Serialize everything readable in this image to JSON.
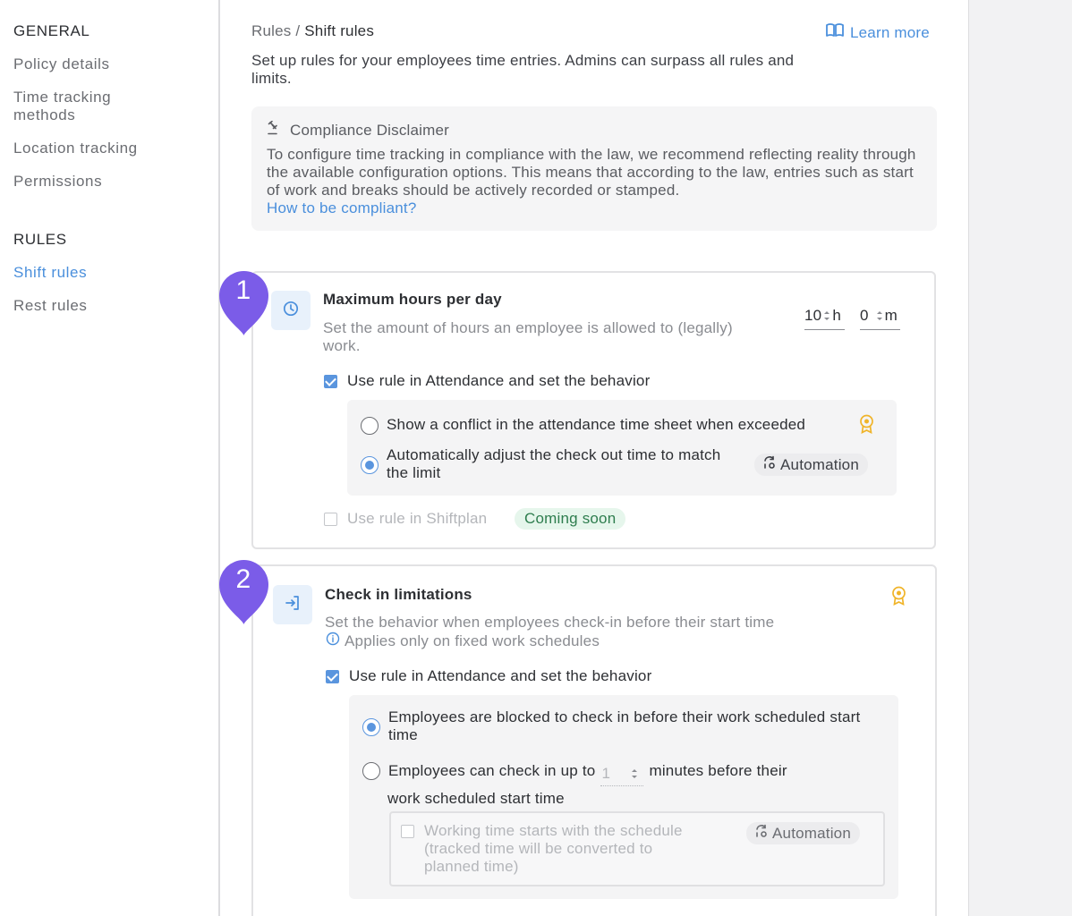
{
  "sidebar": {
    "general_heading": "GENERAL",
    "general_items": [
      {
        "label": "Policy details"
      },
      {
        "label": "Time tracking methods"
      },
      {
        "label": "Location tracking"
      },
      {
        "label": "Permissions"
      }
    ],
    "rules_heading": "RULES",
    "rules_items": [
      {
        "label": "Shift rules",
        "active": true
      },
      {
        "label": "Rest rules",
        "active": false
      }
    ]
  },
  "header": {
    "breadcrumb_parent": "Rules",
    "breadcrumb_separator": " / ",
    "breadcrumb_current": "Shift rules",
    "learn_more": "Learn more",
    "intro": "Set up rules for your employees time entries. Admins can surpass all rules and limits."
  },
  "disclaimer": {
    "title": "Compliance Disclaimer",
    "body": "To configure time tracking in compliance with the law, we recommend reflecting reality through the available configuration options. This means that according to the law, entries such as start of work and breaks should be actively recorded or stamped.",
    "link": "How to be compliant?"
  },
  "rule1": {
    "marker": "1",
    "icon": "clock-icon",
    "title": "Maximum hours per day",
    "description": "Set the amount of hours an employee is allowed to (legally) work.",
    "hours_value": "10",
    "hours_unit": "h",
    "minutes_value": "0",
    "minutes_unit": "m",
    "attendance_label": "Use rule in Attendance and set the behavior",
    "attendance_checked": true,
    "option_conflict": "Show a conflict in the attendance time sheet when exceeded",
    "option_adjust": "Automatically adjust the check out time to match the limit",
    "selected_option": "adjust",
    "automation_badge": "Automation",
    "shiftplan_label": "Use rule in Shiftplan",
    "shiftplan_checked": false,
    "coming_soon": "Coming soon"
  },
  "rule2": {
    "marker": "2",
    "icon": "login-arrow-icon",
    "title": "Check in limitations",
    "description": "Set the behavior when employees check-in before their start time",
    "info_note": "Applies only on fixed work schedules",
    "attendance_label": "Use rule in Attendance and set the behavior",
    "attendance_checked": true,
    "option_blocked": "Employees are blocked to check in before their work scheduled start time",
    "option_early_prefix": "Employees can check in up to",
    "early_minutes": "1",
    "option_early_suffix": "minutes before their",
    "option_early_line2": "work scheduled start time",
    "selected_option": "blocked",
    "sub_option": "Working time starts with the schedule (tracked time will be converted to planned time)",
    "sub_option_checked": false,
    "automation_badge": "Automation"
  },
  "colors": {
    "accent": "#4a8fdc",
    "marker": "#7b5ce8",
    "premium": "#f0b429"
  }
}
